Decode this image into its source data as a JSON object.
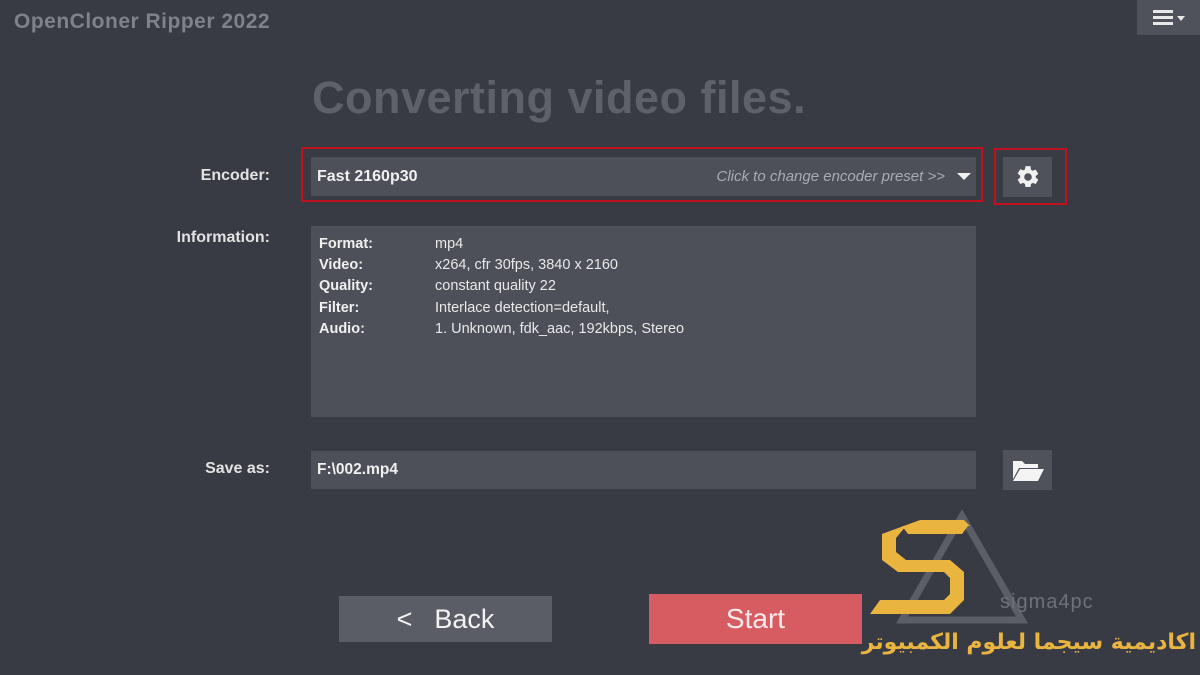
{
  "window": {
    "title": "OpenCloner Ripper 2022"
  },
  "menu": {
    "icon": "hamburger-menu-icon"
  },
  "main": {
    "heading": "Converting video files.",
    "encoder": {
      "label": "Encoder:",
      "value": "Fast 2160p30",
      "hint": "Click to change encoder preset >>",
      "settings_icon": "gear-icon"
    },
    "information": {
      "label": "Information:",
      "rows": [
        {
          "key": "Format:",
          "value": "mp4"
        },
        {
          "key": "Video:",
          "value": "x264, cfr 30fps, 3840 x 2160"
        },
        {
          "key": "Quality:",
          "value": "constant quality 22"
        },
        {
          "key": "Filter:",
          "value": "Interlace detection=default,"
        },
        {
          "key": "Audio:",
          "value": "1. Unknown, fdk_aac, 192kbps, Stereo"
        }
      ]
    },
    "save_as": {
      "label": "Save as:",
      "value": "F:\\002.mp4",
      "browse_icon": "folder-open-icon"
    }
  },
  "footer": {
    "back_arrow": "<",
    "back_label": "Back",
    "start_label": "Start"
  },
  "watermark": {
    "brand": "sigma4pc",
    "arabic": "اكاديمية سيجما لعلوم الكمبيوتر"
  },
  "colors": {
    "background": "#393b44",
    "field": "#4d5059",
    "highlight_border": "#c0121e",
    "start_button": "#d75c62",
    "watermark_gold": "#e9b53f"
  }
}
